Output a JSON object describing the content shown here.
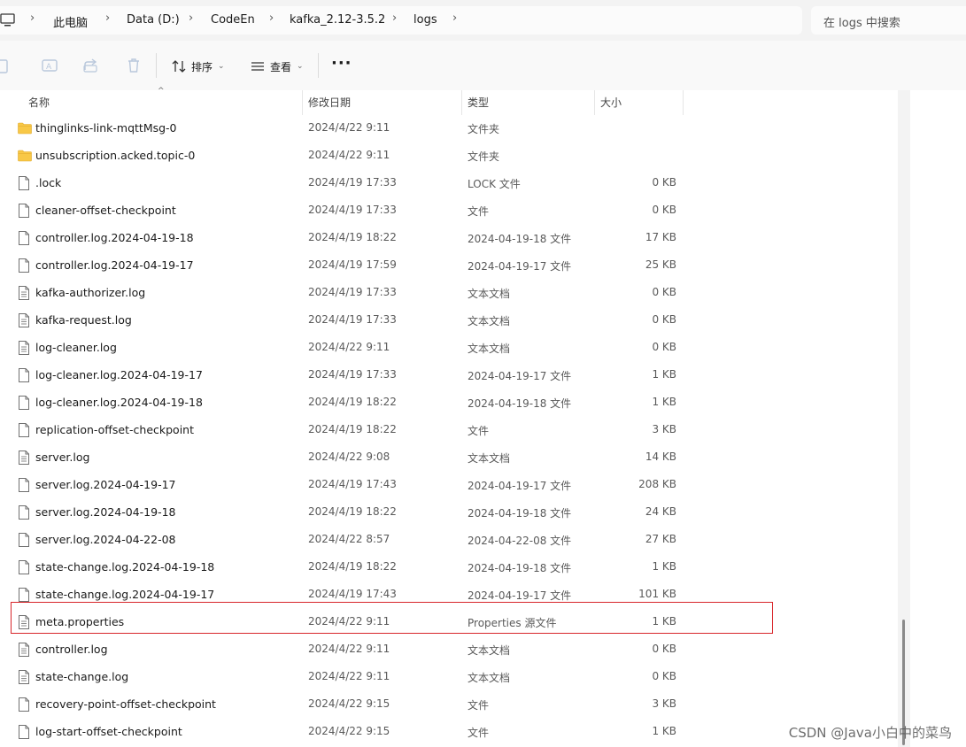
{
  "breadcrumb": {
    "items": [
      "此电脑",
      "Data (D:)",
      "CodeEn",
      "kafka_2.12-3.5.2",
      "logs"
    ]
  },
  "search": {
    "placeholder": "在 logs 中搜索"
  },
  "toolbar": {
    "sort_label": "排序",
    "view_label": "查看",
    "more_label": "···"
  },
  "columns": {
    "name": "名称",
    "date": "修改日期",
    "type": "类型",
    "size": "大小"
  },
  "files": [
    {
      "name": "thinglinks-link-mqttMsg-0",
      "date": "2024/4/22 9:11",
      "type": "文件夹",
      "size": "",
      "kind": "folder"
    },
    {
      "name": "unsubscription.acked.topic-0",
      "date": "2024/4/22 9:11",
      "type": "文件夹",
      "size": "",
      "kind": "folder"
    },
    {
      "name": ".lock",
      "date": "2024/4/19 17:33",
      "type": "LOCK 文件",
      "size": "0 KB",
      "kind": "file"
    },
    {
      "name": "cleaner-offset-checkpoint",
      "date": "2024/4/19 17:33",
      "type": "文件",
      "size": "0 KB",
      "kind": "file"
    },
    {
      "name": "controller.log.2024-04-19-18",
      "date": "2024/4/19 18:22",
      "type": "2024-04-19-18 文件",
      "size": "17 KB",
      "kind": "file"
    },
    {
      "name": "controller.log.2024-04-19-17",
      "date": "2024/4/19 17:59",
      "type": "2024-04-19-17 文件",
      "size": "25 KB",
      "kind": "file"
    },
    {
      "name": "kafka-authorizer.log",
      "date": "2024/4/19 17:33",
      "type": "文本文档",
      "size": "0 KB",
      "kind": "text"
    },
    {
      "name": "kafka-request.log",
      "date": "2024/4/19 17:33",
      "type": "文本文档",
      "size": "0 KB",
      "kind": "text"
    },
    {
      "name": "log-cleaner.log",
      "date": "2024/4/22 9:11",
      "type": "文本文档",
      "size": "0 KB",
      "kind": "text"
    },
    {
      "name": "log-cleaner.log.2024-04-19-17",
      "date": "2024/4/19 17:33",
      "type": "2024-04-19-17 文件",
      "size": "1 KB",
      "kind": "file"
    },
    {
      "name": "log-cleaner.log.2024-04-19-18",
      "date": "2024/4/19 18:22",
      "type": "2024-04-19-18 文件",
      "size": "1 KB",
      "kind": "file"
    },
    {
      "name": "replication-offset-checkpoint",
      "date": "2024/4/19 18:22",
      "type": "文件",
      "size": "3 KB",
      "kind": "file"
    },
    {
      "name": "server.log",
      "date": "2024/4/22 9:08",
      "type": "文本文档",
      "size": "14 KB",
      "kind": "text"
    },
    {
      "name": "server.log.2024-04-19-17",
      "date": "2024/4/19 17:43",
      "type": "2024-04-19-17 文件",
      "size": "208 KB",
      "kind": "file"
    },
    {
      "name": "server.log.2024-04-19-18",
      "date": "2024/4/19 18:22",
      "type": "2024-04-19-18 文件",
      "size": "24 KB",
      "kind": "file"
    },
    {
      "name": "server.log.2024-04-22-08",
      "date": "2024/4/22 8:57",
      "type": "2024-04-22-08 文件",
      "size": "27 KB",
      "kind": "file"
    },
    {
      "name": "state-change.log.2024-04-19-18",
      "date": "2024/4/19 18:22",
      "type": "2024-04-19-18 文件",
      "size": "1 KB",
      "kind": "file"
    },
    {
      "name": "state-change.log.2024-04-19-17",
      "date": "2024/4/19 17:43",
      "type": "2024-04-19-17 文件",
      "size": "101 KB",
      "kind": "file"
    },
    {
      "name": "meta.properties",
      "date": "2024/4/22 9:11",
      "type": "Properties 源文件",
      "size": "1 KB",
      "kind": "text"
    },
    {
      "name": "controller.log",
      "date": "2024/4/22 9:11",
      "type": "文本文档",
      "size": "0 KB",
      "kind": "text"
    },
    {
      "name": "state-change.log",
      "date": "2024/4/22 9:11",
      "type": "文本文档",
      "size": "0 KB",
      "kind": "text"
    },
    {
      "name": "recovery-point-offset-checkpoint",
      "date": "2024/4/22 9:15",
      "type": "文件",
      "size": "3 KB",
      "kind": "file"
    },
    {
      "name": "log-start-offset-checkpoint",
      "date": "2024/4/22 9:15",
      "type": "文件",
      "size": "1 KB",
      "kind": "file"
    }
  ],
  "highlight": {
    "row_name": "meta.properties",
    "color": "#d8262b"
  },
  "scrollbar": {
    "position_fraction": 0.85
  },
  "watermark": "CSDN @Java小白中的菜鸟",
  "colors": {
    "folder": "#f8c847",
    "accent": "#d8262b"
  }
}
